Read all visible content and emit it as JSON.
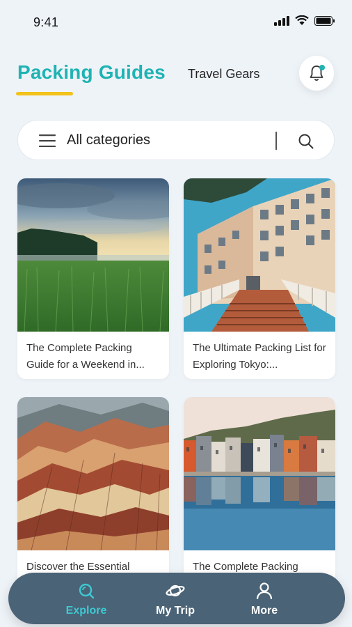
{
  "status_bar": {
    "time": "9:41"
  },
  "tabs": {
    "active": "Packing Guides",
    "inactive": "Travel Gears"
  },
  "search": {
    "label": "All categories"
  },
  "cards": [
    {
      "title": "The Complete Packing Guide for a Weekend in..."
    },
    {
      "title": "The Ultimate Packing List for Exploring Tokyo:..."
    },
    {
      "title": "Discover the Essential"
    },
    {
      "title": "The Complete Packing"
    }
  ],
  "bottom_nav": {
    "items": [
      {
        "label": "Explore",
        "icon": "explore-icon",
        "active": true
      },
      {
        "label": "My Trip",
        "icon": "planet-icon",
        "active": false
      },
      {
        "label": "More",
        "icon": "person-icon",
        "active": false
      }
    ]
  },
  "colors": {
    "accent": "#1fb3b3",
    "underline": "#f2c21a",
    "nav_bg": "#4a6376",
    "page_bg": "#eef3f8"
  }
}
